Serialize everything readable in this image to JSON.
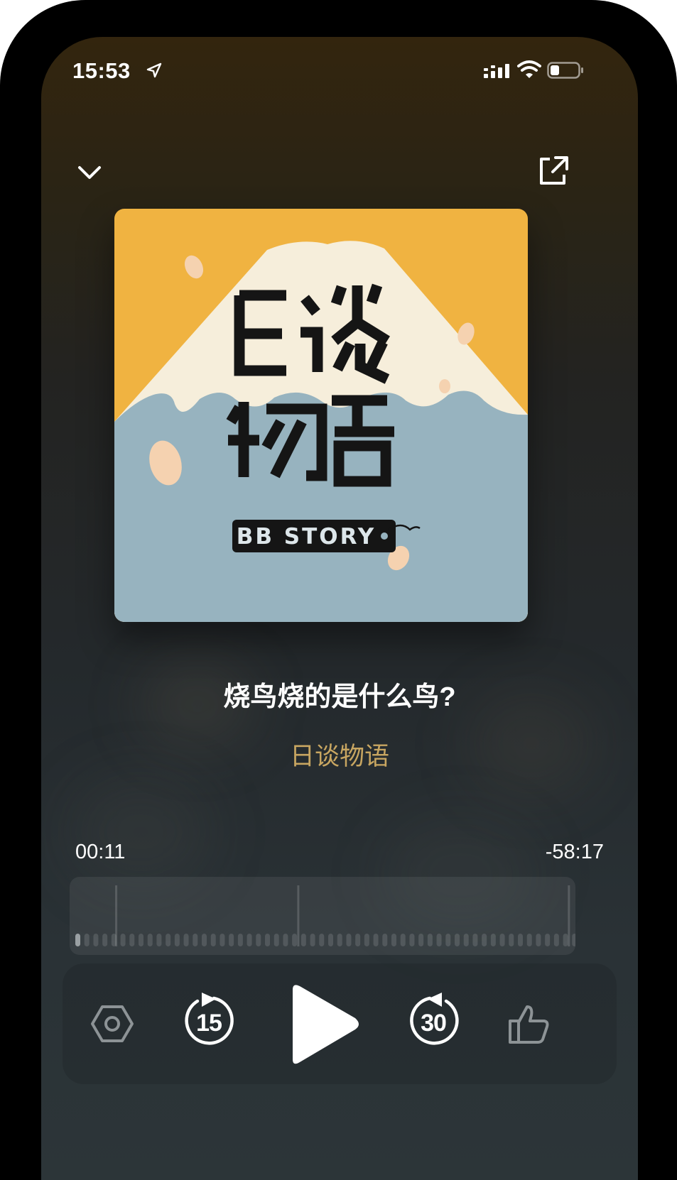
{
  "status_bar": {
    "time": "15:53"
  },
  "episode": {
    "title": "烧鸟烧的是什么鸟?",
    "podcast": "日谈物语"
  },
  "cover": {
    "logo_text": "BB STORY"
  },
  "progress": {
    "elapsed": "00:11",
    "remaining": "-58:17",
    "fraction": 0.003
  },
  "controls": {
    "skip_back_seconds": "15",
    "skip_forward_seconds": "30"
  },
  "colors": {
    "accent": "#c8a661",
    "cover_yellow": "#f0b341",
    "cover_blue": "#97b3bf",
    "cover_cream": "#f6eedb"
  }
}
